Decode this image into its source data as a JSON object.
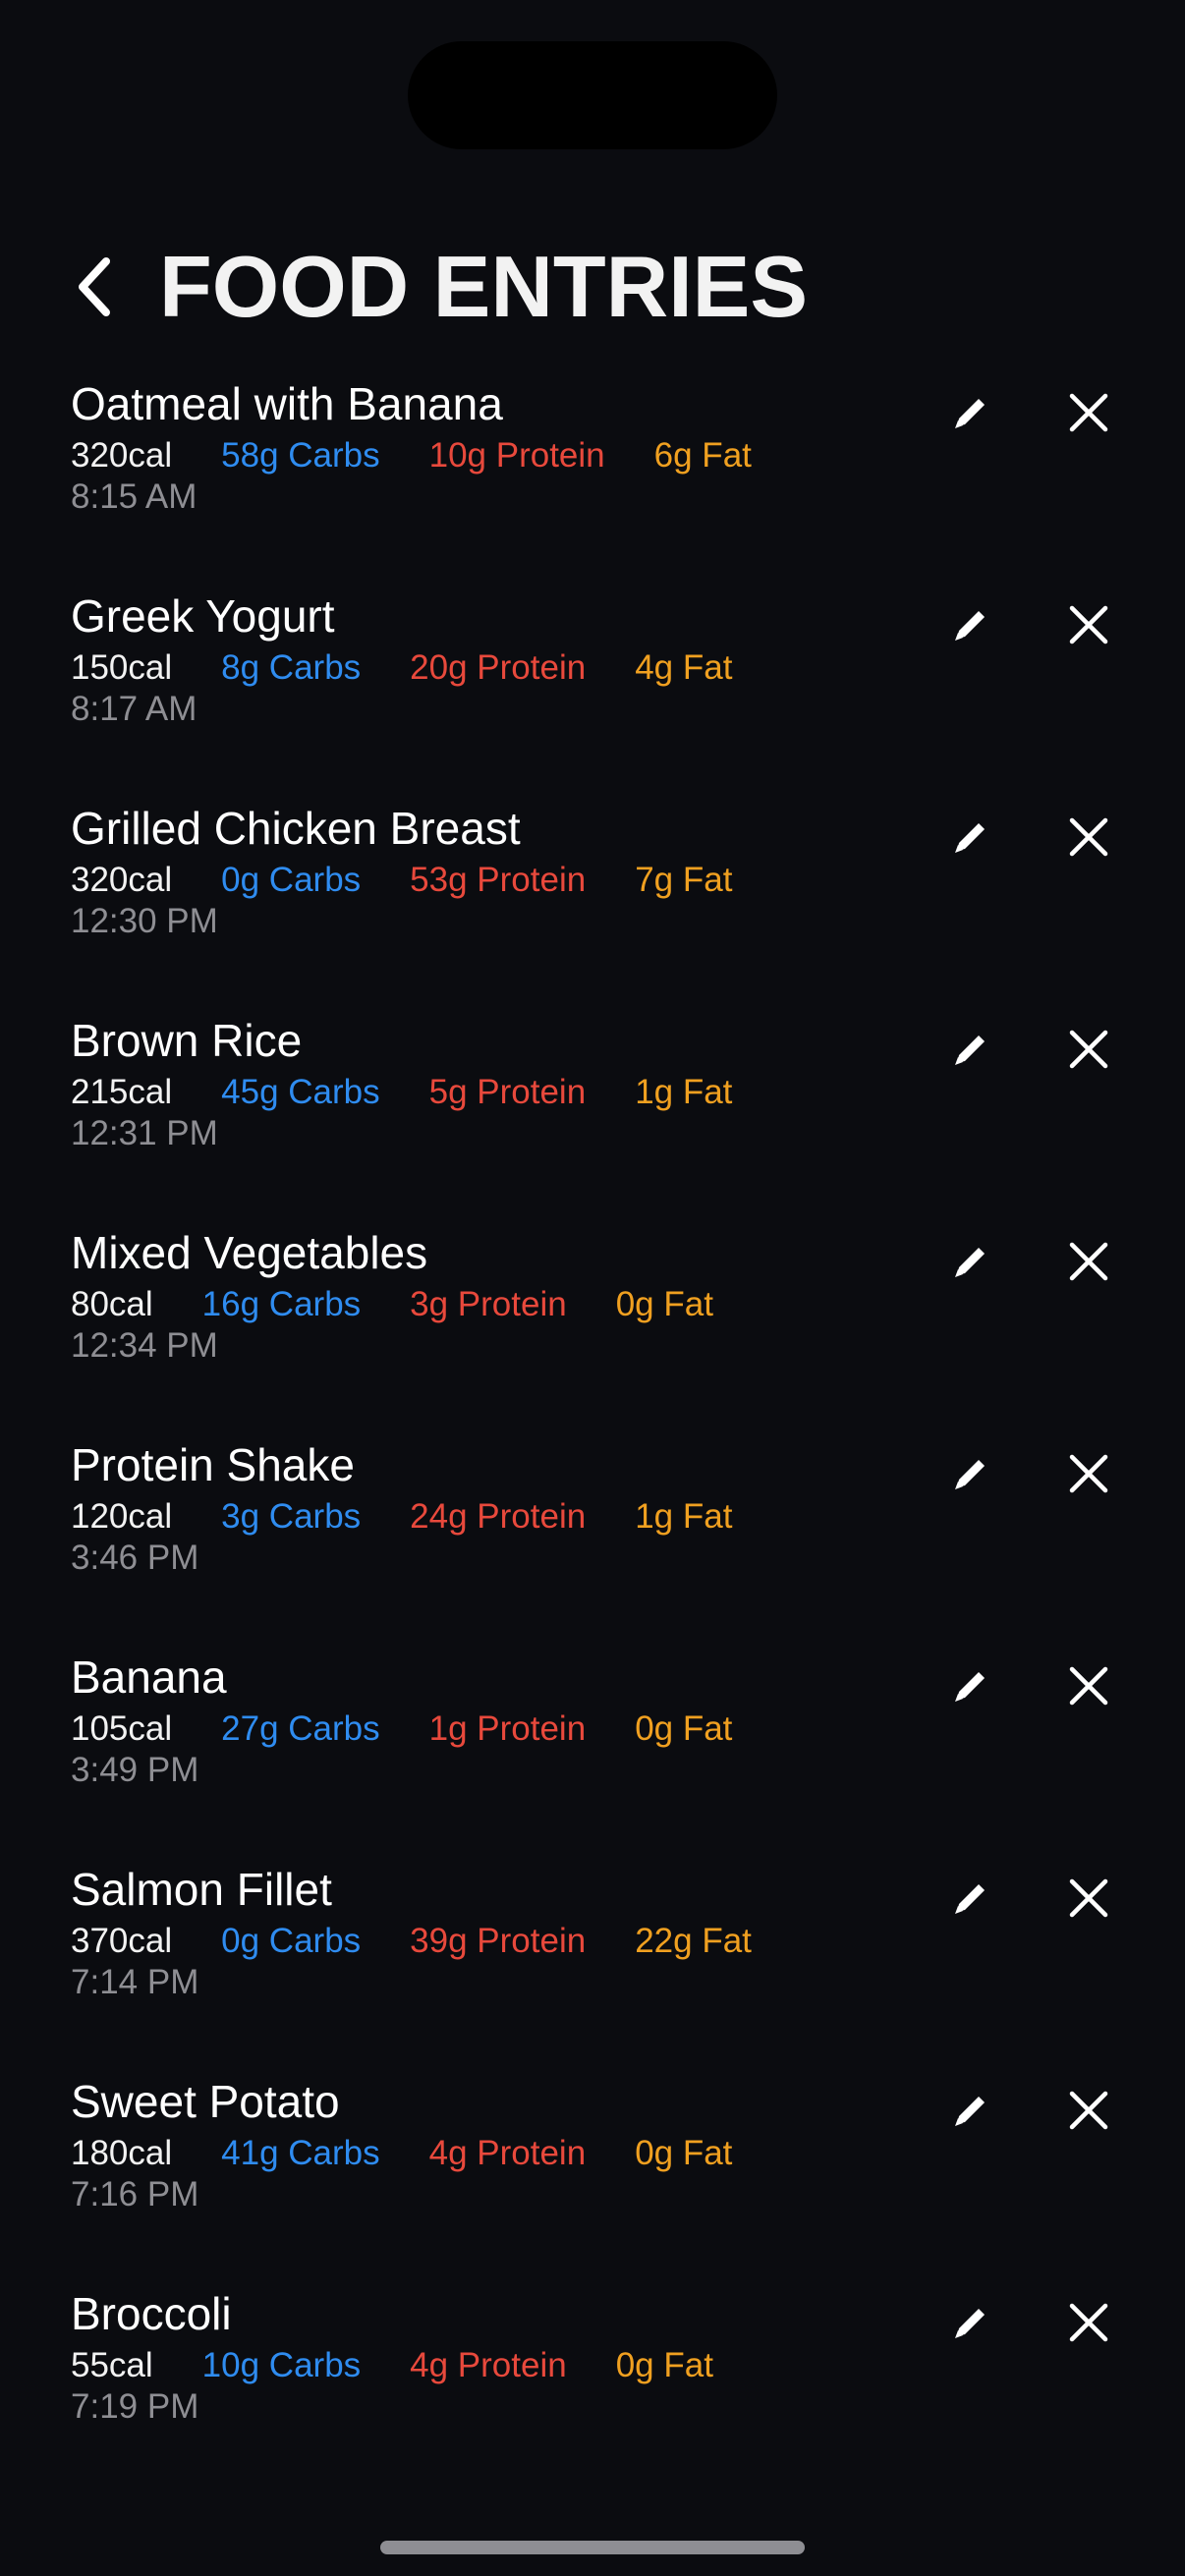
{
  "header": {
    "title": "FOOD ENTRIES",
    "back_icon": "chevron-left-icon"
  },
  "icons": {
    "edit": "pencil-icon",
    "delete": "close-icon"
  },
  "colors": {
    "background": "#0b0c10",
    "carbs": "#2f8cf0",
    "protein": "#e8493c",
    "fat": "#f0a020",
    "time": "#8e8e93"
  },
  "entries": [
    {
      "name": "Oatmeal with Banana",
      "calories": "320cal",
      "carbs": "58g Carbs",
      "protein": "10g Protein",
      "fat": "6g Fat",
      "time": "8:15 AM"
    },
    {
      "name": "Greek Yogurt",
      "calories": "150cal",
      "carbs": "8g Carbs",
      "protein": "20g Protein",
      "fat": "4g Fat",
      "time": "8:17 AM"
    },
    {
      "name": "Grilled Chicken Breast",
      "calories": "320cal",
      "carbs": "0g Carbs",
      "protein": "53g Protein",
      "fat": "7g Fat",
      "time": "12:30 PM"
    },
    {
      "name": "Brown Rice",
      "calories": "215cal",
      "carbs": "45g Carbs",
      "protein": "5g Protein",
      "fat": "1g Fat",
      "time": "12:31 PM"
    },
    {
      "name": "Mixed Vegetables",
      "calories": "80cal",
      "carbs": "16g Carbs",
      "protein": "3g Protein",
      "fat": "0g Fat",
      "time": "12:34 PM"
    },
    {
      "name": "Protein Shake",
      "calories": "120cal",
      "carbs": "3g Carbs",
      "protein": "24g Protein",
      "fat": "1g Fat",
      "time": "3:46 PM"
    },
    {
      "name": "Banana",
      "calories": "105cal",
      "carbs": "27g Carbs",
      "protein": "1g Protein",
      "fat": "0g Fat",
      "time": "3:49 PM"
    },
    {
      "name": "Salmon Fillet",
      "calories": "370cal",
      "carbs": "0g Carbs",
      "protein": "39g Protein",
      "fat": "22g Fat",
      "time": "7:14 PM"
    },
    {
      "name": "Sweet Potato",
      "calories": "180cal",
      "carbs": "41g Carbs",
      "protein": "4g Protein",
      "fat": "0g Fat",
      "time": "7:16 PM"
    },
    {
      "name": "Broccoli",
      "calories": "55cal",
      "carbs": "10g Carbs",
      "protein": "4g Protein",
      "fat": "0g Fat",
      "time": "7:19 PM"
    }
  ]
}
